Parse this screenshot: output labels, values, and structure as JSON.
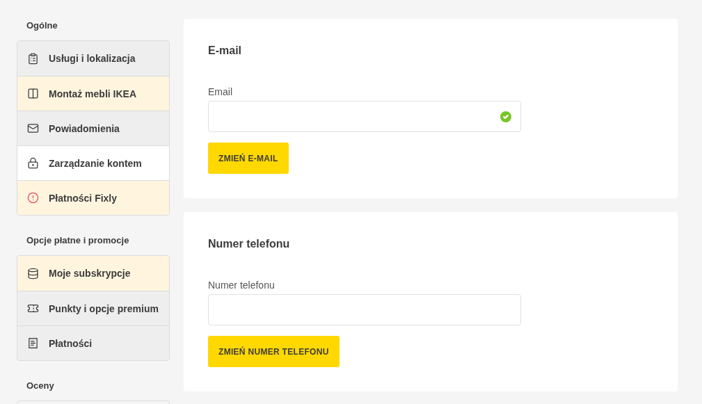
{
  "sidebar": [
    {
      "heading": "Ogólne",
      "items": [
        {
          "label": "Usługi i lokalizacja",
          "selected": false,
          "highlighted": false
        },
        {
          "label": "Montaż mebli IKEA",
          "selected": false,
          "highlighted": true
        },
        {
          "label": "Powiadomienia",
          "selected": false,
          "highlighted": false
        },
        {
          "label": "Zarządzanie kontem",
          "selected": true,
          "highlighted": false
        },
        {
          "label": "Płatności Fixly",
          "selected": false,
          "highlighted": true
        }
      ]
    },
    {
      "heading": "Opcje płatne i promocje",
      "items": [
        {
          "label": "Moje subskrypcje",
          "selected": false,
          "highlighted": true
        },
        {
          "label": "Punkty i opcje premium",
          "selected": false,
          "highlighted": false
        },
        {
          "label": "Płatności",
          "selected": false,
          "highlighted": false
        }
      ]
    },
    {
      "heading": "Oceny"
    }
  ],
  "cards": [
    {
      "title": "E-mail",
      "field_label": "Email",
      "valid": true,
      "button": "ZMIEŃ E-MAIL"
    },
    {
      "title": "Numer telefonu",
      "field_label": "Numer telefonu",
      "valid": false,
      "button": "ZMIEŃ NUMER TELEFONU"
    }
  ]
}
